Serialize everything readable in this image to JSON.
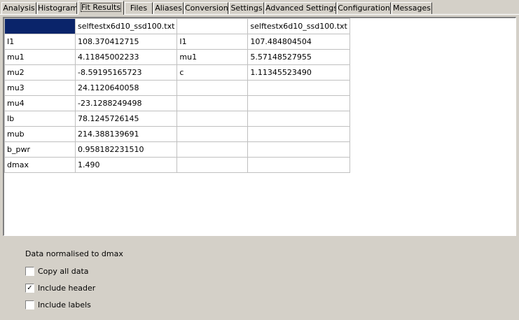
{
  "tabs": [
    {
      "label": "Analysis",
      "active": false
    },
    {
      "label": "Histogram",
      "active": false
    },
    {
      "label": "Fit Results",
      "active": true
    },
    {
      "label": "Files",
      "active": false
    },
    {
      "label": "Aliases",
      "active": false
    },
    {
      "label": "Conversion",
      "active": false
    },
    {
      "label": "Settings",
      "active": false
    },
    {
      "label": "Advanced Settings",
      "active": false
    },
    {
      "label": "Configuration",
      "active": false
    },
    {
      "label": "Messages",
      "active": false
    }
  ],
  "grid": {
    "file_headers": [
      "selftestx6d10_ssd100.txt",
      "selftestx6d10_ssd100.txt"
    ],
    "rows": [
      [
        "I1",
        "108.370412715",
        "I1",
        "107.484804504"
      ],
      [
        "mu1",
        "4.11845002233",
        "mu1",
        "5.57148527955"
      ],
      [
        "mu2",
        "-8.59195165723",
        "c",
        "1.11345523490"
      ],
      [
        "mu3",
        "24.1120640058",
        "",
        ""
      ],
      [
        "mu4",
        "-23.1288249498",
        "",
        ""
      ],
      [
        "Ib",
        "78.1245726145",
        "",
        ""
      ],
      [
        "mub",
        "214.388139691",
        "",
        ""
      ],
      [
        "b_pwr",
        "0.958182231510",
        "",
        ""
      ],
      [
        "dmax",
        "1.490",
        "",
        ""
      ]
    ]
  },
  "status_note": "Data normalised to dmax",
  "options": [
    {
      "label": "Copy all data",
      "checked": false
    },
    {
      "label": "Include header",
      "checked": true
    },
    {
      "label": "Include labels",
      "checked": false
    }
  ]
}
